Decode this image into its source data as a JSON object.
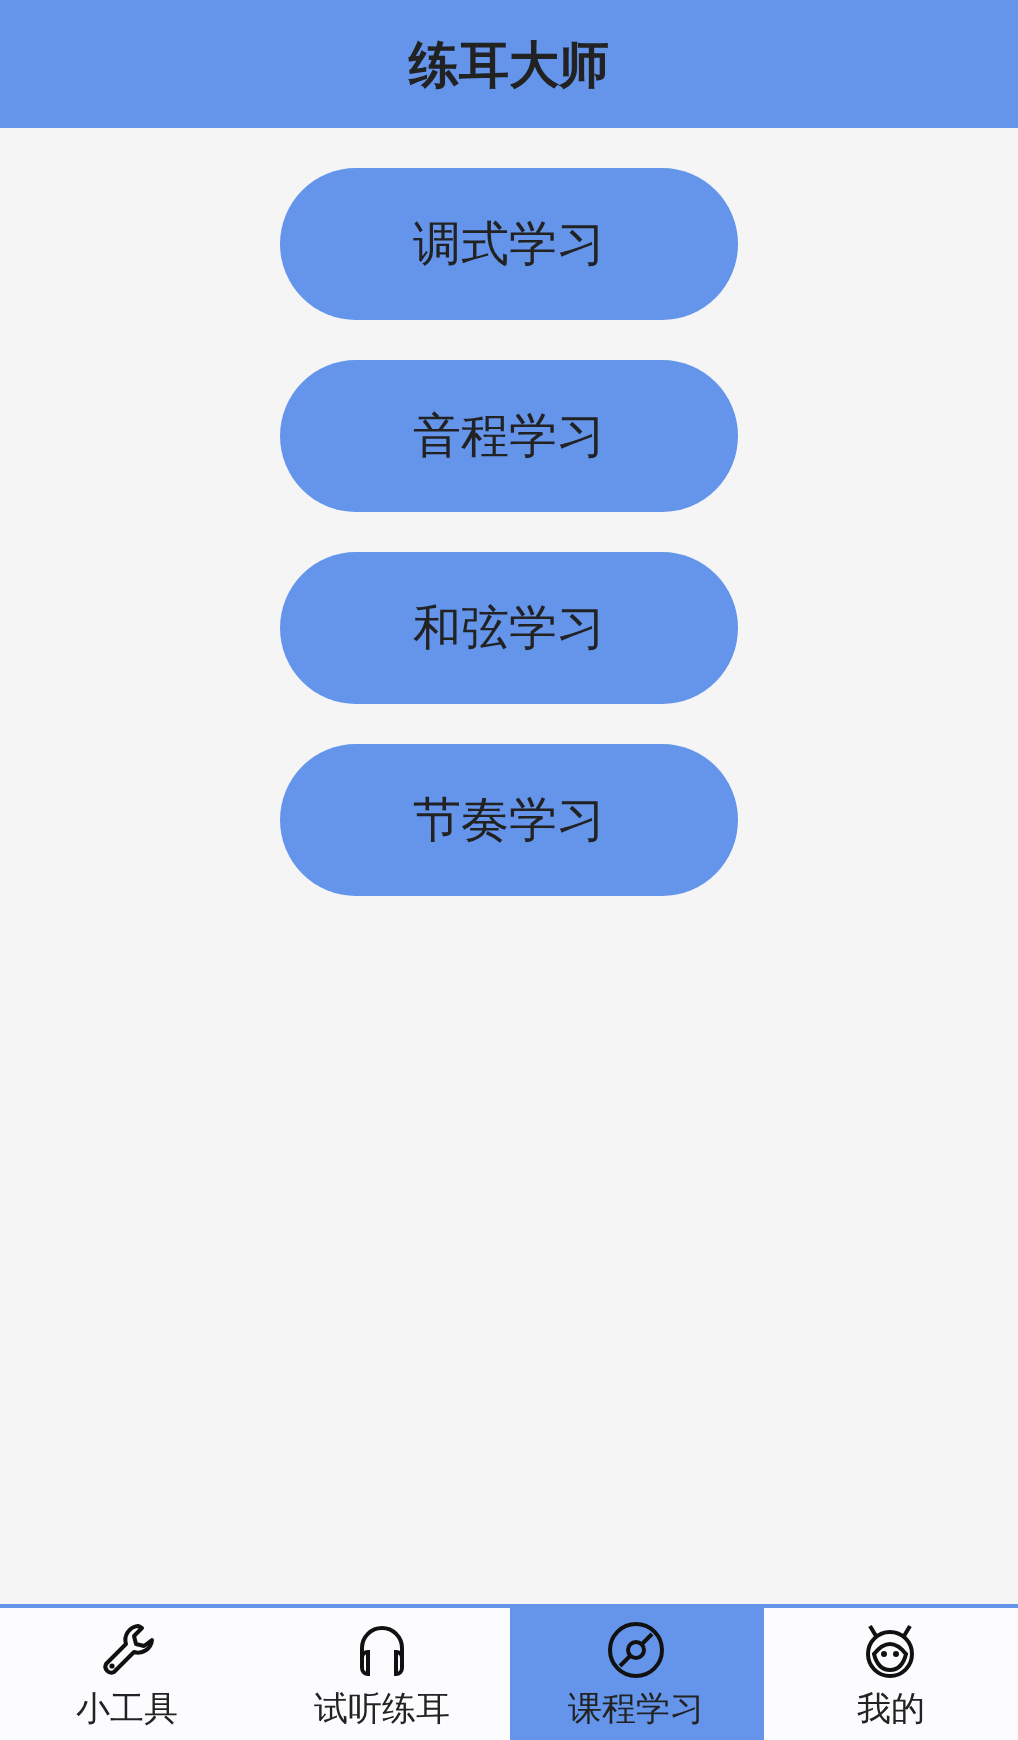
{
  "header": {
    "title": "练耳大师"
  },
  "courses": [
    {
      "label": "调式学习"
    },
    {
      "label": "音程学习"
    },
    {
      "label": "和弦学习"
    },
    {
      "label": "节奏学习"
    }
  ],
  "tab_bar": [
    {
      "label": "小工具",
      "kind": "wrench",
      "selected": false
    },
    {
      "label": "试听练耳",
      "kind": "headphones",
      "selected": false
    },
    {
      "label": "课程学习",
      "kind": "disc",
      "selected": true
    },
    {
      "label": "我的",
      "kind": "mascot",
      "selected": false
    }
  ]
}
